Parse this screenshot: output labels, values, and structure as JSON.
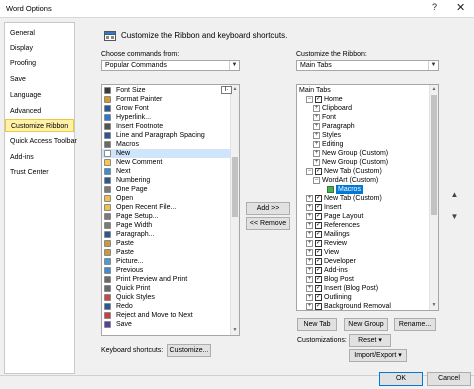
{
  "window": {
    "title": "Word Options",
    "help_label": "?",
    "close_label": "✕"
  },
  "nav": {
    "items": [
      {
        "label": "General"
      },
      {
        "label": "Display"
      },
      {
        "label": "Proofing"
      },
      {
        "label": "Save"
      },
      {
        "label": "Language"
      },
      {
        "label": "Advanced"
      },
      {
        "label": "Customize Ribbon",
        "active": true
      },
      {
        "label": "Quick Access Toolbar"
      },
      {
        "label": "Add-ins"
      },
      {
        "label": "Trust Center"
      }
    ]
  },
  "banner": {
    "text": "Customize the Ribbon and keyboard shortcuts."
  },
  "left": {
    "label": "Choose commands from:",
    "combo_value": "Popular Commands",
    "commands": [
      {
        "label": "Font Size",
        "icon": "font-size-icon",
        "color": "#3a3a3a"
      },
      {
        "label": "Format Painter",
        "icon": "paintbrush-icon",
        "color": "#d39b2b"
      },
      {
        "label": "Grow Font",
        "icon": "grow-font-icon",
        "color": "#2b5797"
      },
      {
        "label": "Hyperlink...",
        "icon": "link-icon",
        "color": "#2b7bd3"
      },
      {
        "label": "Insert Footnote",
        "icon": "footnote-icon",
        "color": "#555555"
      },
      {
        "label": "Line and Paragraph Spacing",
        "icon": "spacing-icon",
        "color": "#2b5797"
      },
      {
        "label": "Macros",
        "icon": "macros-icon",
        "color": "#6a6a6a"
      },
      {
        "label": "New",
        "icon": "new-doc-icon",
        "color": "#ffffff",
        "selected": true
      },
      {
        "label": "New Comment",
        "icon": "comment-icon",
        "color": "#f4c84a"
      },
      {
        "label": "Next",
        "icon": "next-icon",
        "color": "#3b8dd8"
      },
      {
        "label": "Numbering",
        "icon": "numbering-icon",
        "color": "#2b5797"
      },
      {
        "label": "One Page",
        "icon": "one-page-icon",
        "color": "#7a7a7a"
      },
      {
        "label": "Open",
        "icon": "folder-icon",
        "color": "#f0c04a"
      },
      {
        "label": "Open Recent File...",
        "icon": "recent-icon",
        "color": "#f0c04a"
      },
      {
        "label": "Page Setup...",
        "icon": "page-setup-icon",
        "color": "#7a7a7a"
      },
      {
        "label": "Page Width",
        "icon": "page-width-icon",
        "color": "#7a7a7a"
      },
      {
        "label": "Paragraph...",
        "icon": "paragraph-icon",
        "color": "#2b5797"
      },
      {
        "label": "Paste",
        "icon": "paste-icon",
        "color": "#c79a3c"
      },
      {
        "label": "Paste",
        "icon": "paste-icon",
        "color": "#c79a3c"
      },
      {
        "label": "Picture...",
        "icon": "picture-icon",
        "color": "#4d9ad6"
      },
      {
        "label": "Previous",
        "icon": "previous-icon",
        "color": "#3b8dd8"
      },
      {
        "label": "Print Preview and Print",
        "icon": "print-icon",
        "color": "#6a6a6a"
      },
      {
        "label": "Quick Print",
        "icon": "quick-print-icon",
        "color": "#6a6a6a"
      },
      {
        "label": "Quick Styles",
        "icon": "styles-icon",
        "color": "#c64a4a"
      },
      {
        "label": "Redo",
        "icon": "redo-icon",
        "color": "#2b5797"
      },
      {
        "label": "Reject and Move to Next",
        "icon": "reject-icon",
        "color": "#c84040"
      },
      {
        "label": "Save",
        "icon": "save-icon",
        "color": "#5b3fa0"
      }
    ],
    "font_size_indicator": "I·"
  },
  "middle": {
    "add_label": "Add >>",
    "remove_label": "<< Remove"
  },
  "right": {
    "label": "Customize the Ribbon:",
    "combo_value": "Main Tabs",
    "tree": [
      {
        "label": "Main Tabs",
        "level": 0,
        "exp": "",
        "cb": ""
      },
      {
        "label": "Home",
        "level": 1,
        "exp": "−",
        "cb": "✓"
      },
      {
        "label": "Clipboard",
        "level": 2,
        "exp": "+",
        "cb": ""
      },
      {
        "label": "Font",
        "level": 2,
        "exp": "+",
        "cb": ""
      },
      {
        "label": "Paragraph",
        "level": 2,
        "exp": "+",
        "cb": ""
      },
      {
        "label": "Styles",
        "level": 2,
        "exp": "+",
        "cb": ""
      },
      {
        "label": "Editing",
        "level": 2,
        "exp": "+",
        "cb": ""
      },
      {
        "label": "New Group (Custom)",
        "level": 2,
        "exp": "+",
        "cb": ""
      },
      {
        "label": "New Group (Custom)",
        "level": 2,
        "exp": "+",
        "cb": ""
      },
      {
        "label": "New Tab (Custom)",
        "level": 1,
        "exp": "−",
        "cb": "✓"
      },
      {
        "label": "WordArt (Custom)",
        "level": 2,
        "exp": "−",
        "cb": ""
      },
      {
        "label": "Macros",
        "level": 3,
        "exp": "",
        "cb": "",
        "selected": true
      },
      {
        "label": "New Tab (Custom)",
        "level": 1,
        "exp": "+",
        "cb": "✓"
      },
      {
        "label": "Insert",
        "level": 1,
        "exp": "+",
        "cb": "✓"
      },
      {
        "label": "Page Layout",
        "level": 1,
        "exp": "+",
        "cb": "✓"
      },
      {
        "label": "References",
        "level": 1,
        "exp": "+",
        "cb": "✓"
      },
      {
        "label": "Mailings",
        "level": 1,
        "exp": "+",
        "cb": "✓"
      },
      {
        "label": "Review",
        "level": 1,
        "exp": "+",
        "cb": "✓"
      },
      {
        "label": "View",
        "level": 1,
        "exp": "+",
        "cb": "✓"
      },
      {
        "label": "Developer",
        "level": 1,
        "exp": "+",
        "cb": "✓"
      },
      {
        "label": "Add-ins",
        "level": 1,
        "exp": "+",
        "cb": "✓"
      },
      {
        "label": "Blog Post",
        "level": 1,
        "exp": "+",
        "cb": "✓"
      },
      {
        "label": "Insert (Blog Post)",
        "level": 1,
        "exp": "+",
        "cb": "✓"
      },
      {
        "label": "Outlining",
        "level": 1,
        "exp": "+",
        "cb": "✓"
      },
      {
        "label": "Background Removal",
        "level": 1,
        "exp": "+",
        "cb": "✓"
      }
    ],
    "new_tab_label": "New Tab",
    "new_group_label": "New Group",
    "rename_label": "Rename...",
    "customizations_label": "Customizations:",
    "reset_label": "Reset ▾",
    "import_export_label": "Import/Export ▾"
  },
  "keyboard": {
    "label": "Keyboard shortcuts:",
    "customize_label": "Customize..."
  },
  "footer": {
    "ok_label": "OK",
    "cancel_label": "Cancel"
  }
}
